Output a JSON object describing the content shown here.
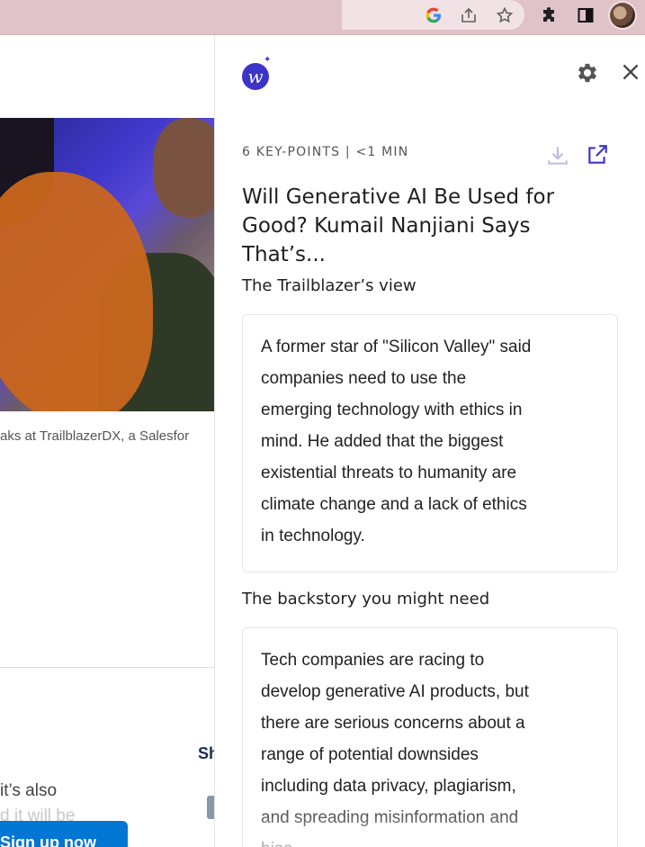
{
  "browser": {
    "toolbar_icons": [
      "google-icon",
      "share-icon",
      "bookmark-star-icon",
      "extensions-puzzle-icon",
      "side-panel-icon",
      "profile-avatar"
    ]
  },
  "article": {
    "caption": "aks at TrailblazerDX, a Salesfor",
    "share_label": "Sh",
    "body_line1": "it’s also",
    "body_line2": "d it will be",
    "signup_label": "Sign up now"
  },
  "panel": {
    "logo_letter": "w",
    "meta": "6 KEY-POINTS | <1 MIN",
    "title": "Will Generative AI Be Used for Good? Kumail Nanjiani Says That’s...",
    "sections": [
      {
        "heading": "The Trailblazer’s view",
        "lines": [
          "A former star of \"Silicon Valley\" said",
          "companies need to use the",
          "emerging technology with ethics in",
          "mind. He added that the biggest",
          "existential threats to humanity are",
          "climate change and a lack of ethics",
          "in technology."
        ]
      },
      {
        "heading": "The backstory you might need",
        "lines": [
          "Tech companies are racing to",
          "develop generative AI products, but",
          "there are serious concerns about a",
          "range of potential downsides",
          "including data privacy, plagiarism,",
          "and spreading misinformation and",
          "bias."
        ]
      }
    ]
  },
  "colors": {
    "accent": "#3b35c7",
    "toolbar": "#dfc3c8",
    "signup": "#0176d3"
  }
}
